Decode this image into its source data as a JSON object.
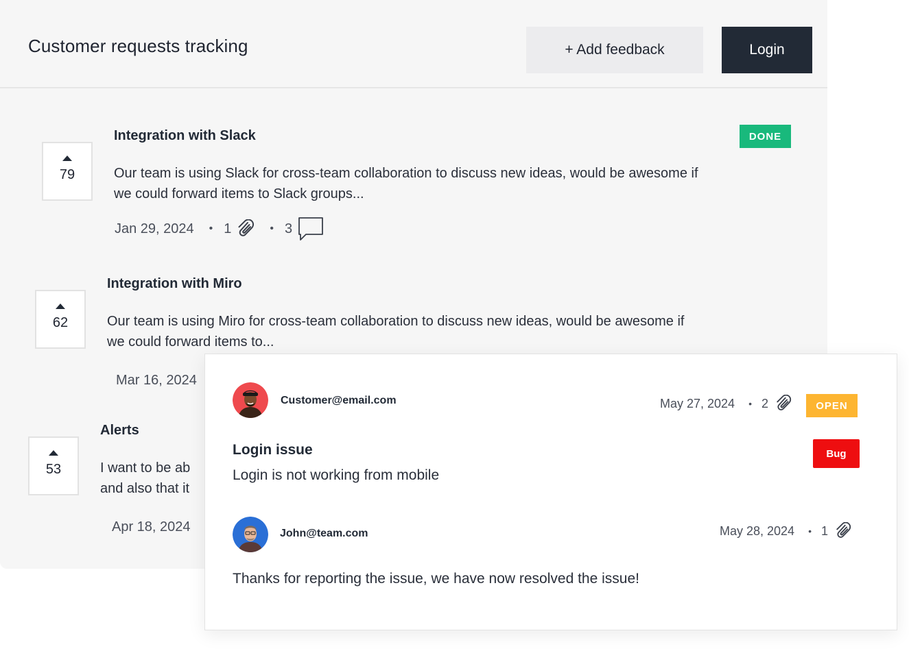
{
  "header": {
    "title": "Customer requests tracking",
    "add_feedback_label": "+ Add feedback",
    "login_label": "Login"
  },
  "requests": [
    {
      "votes": "79",
      "title": "Integration with Slack",
      "description": "Our team is using Slack for cross-team collaboration to discuss new ideas, would be awesome if we could forward items to Slack groups...",
      "date": "Jan 29, 2024",
      "attachments": "1",
      "comments": "3",
      "status": "DONE"
    },
    {
      "votes": "62",
      "title": "Integration with Miro",
      "description": "Our team is using Miro for cross-team collaboration to discuss new ideas, would be awesome if we could forward items to...",
      "date": "Mar 16, 2024"
    },
    {
      "votes": "53",
      "title": "Alerts",
      "description": "I want to be ab and also that it",
      "description_line1": "I want to be ab",
      "description_line2": "and also that it",
      "date": "Apr 18, 2024"
    }
  ],
  "detail": {
    "report": {
      "email": "Customer@email.com",
      "date": "May 27, 2024",
      "attachments": "2",
      "status": "OPEN",
      "tag": "Bug",
      "title": "Login issue",
      "body": "Login is not working from mobile"
    },
    "reply": {
      "email": "John@team.com",
      "date": "May 28, 2024",
      "attachments": "1",
      "body": "Thanks for reporting the issue, we have now resolved the issue!"
    }
  },
  "icons": {
    "attachment": "paperclip-icon",
    "comments": "speech-bubble-icon",
    "upvote": "caret-up-icon"
  },
  "colors": {
    "done": "#19b97c",
    "open": "#fdb531",
    "bug": "#ee0e10",
    "primary_button": "#222a36"
  }
}
